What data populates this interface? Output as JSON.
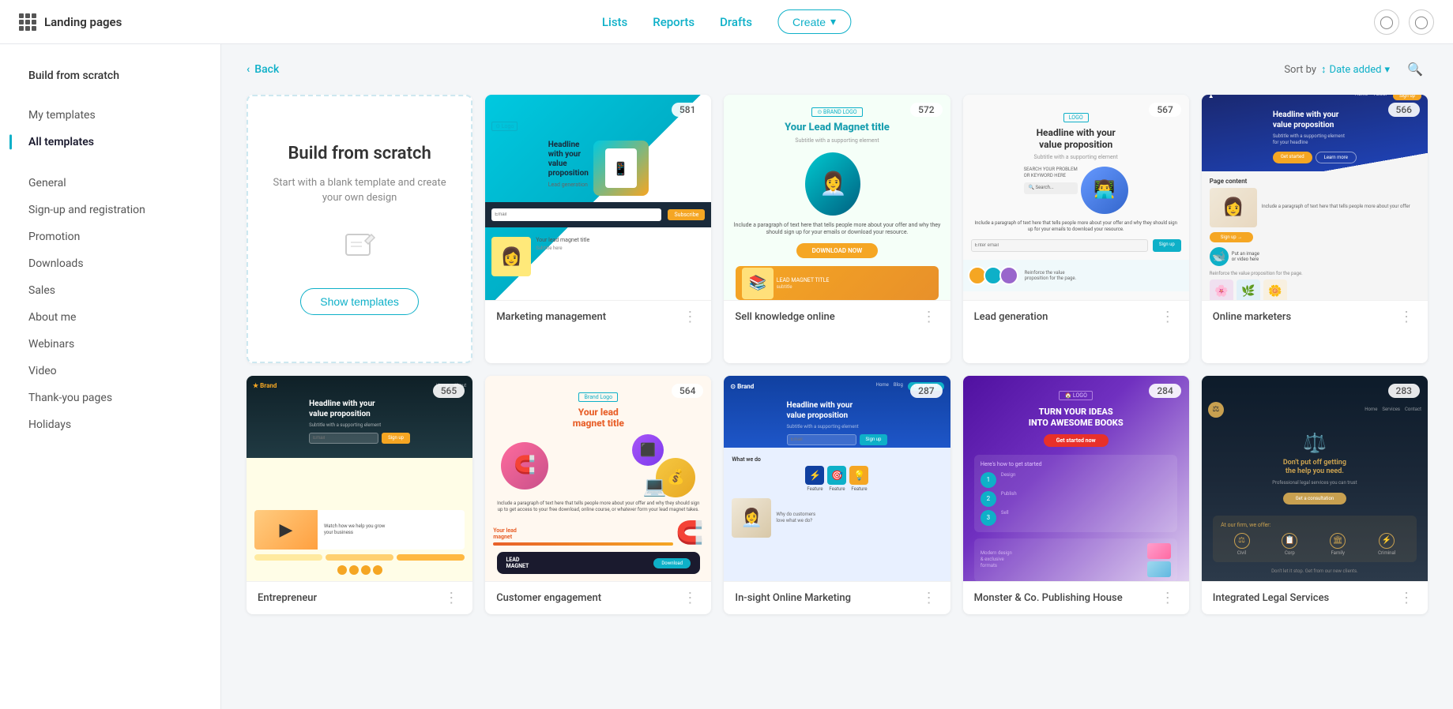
{
  "app": {
    "title": "Landing pages"
  },
  "topnav": {
    "lists": "Lists",
    "reports": "Reports",
    "drafts": "Drafts",
    "create": "Create"
  },
  "breadcrumb": {
    "back": "Back"
  },
  "toolbar": {
    "sort_label": "Sort by",
    "sort_value": "Date added"
  },
  "sidebar": {
    "build_from_scratch": "Build from scratch",
    "my_templates": "My templates",
    "all_templates": "All templates",
    "categories": [
      {
        "id": "general",
        "label": "General"
      },
      {
        "id": "signup",
        "label": "Sign-up and registration"
      },
      {
        "id": "promotion",
        "label": "Promotion"
      },
      {
        "id": "downloads",
        "label": "Downloads"
      },
      {
        "id": "sales",
        "label": "Sales"
      },
      {
        "id": "about_me",
        "label": "About me"
      },
      {
        "id": "webinars",
        "label": "Webinars"
      },
      {
        "id": "video",
        "label": "Video"
      },
      {
        "id": "thankyou",
        "label": "Thank-you pages"
      },
      {
        "id": "holidays",
        "label": "Holidays"
      }
    ]
  },
  "scratch_card": {
    "title": "Build from scratch",
    "subtitle": "Start with a blank template and create your own design",
    "button": "Show templates"
  },
  "templates": [
    {
      "id": "marketing",
      "name": "Marketing management",
      "count": "581",
      "visual": "marketing"
    },
    {
      "id": "sell",
      "name": "Sell knowledge online",
      "count": "572",
      "visual": "sell"
    },
    {
      "id": "lead",
      "name": "Lead generation",
      "count": "567",
      "visual": "lead"
    },
    {
      "id": "online",
      "name": "Online marketers",
      "count": "566",
      "visual": "online"
    },
    {
      "id": "entrepreneur",
      "name": "Entrepreneur",
      "count": "565",
      "visual": "entrepreneur"
    },
    {
      "id": "customer",
      "name": "Customer engagement",
      "count": "564",
      "visual": "customer"
    },
    {
      "id": "insight",
      "name": "In-sight Online Marketing",
      "count": "287",
      "visual": "insight"
    },
    {
      "id": "monster",
      "name": "Monster & Co. Publishing House",
      "count": "284",
      "visual": "monster"
    },
    {
      "id": "legal",
      "name": "Integrated Legal Services",
      "count": "283",
      "visual": "legal"
    }
  ]
}
